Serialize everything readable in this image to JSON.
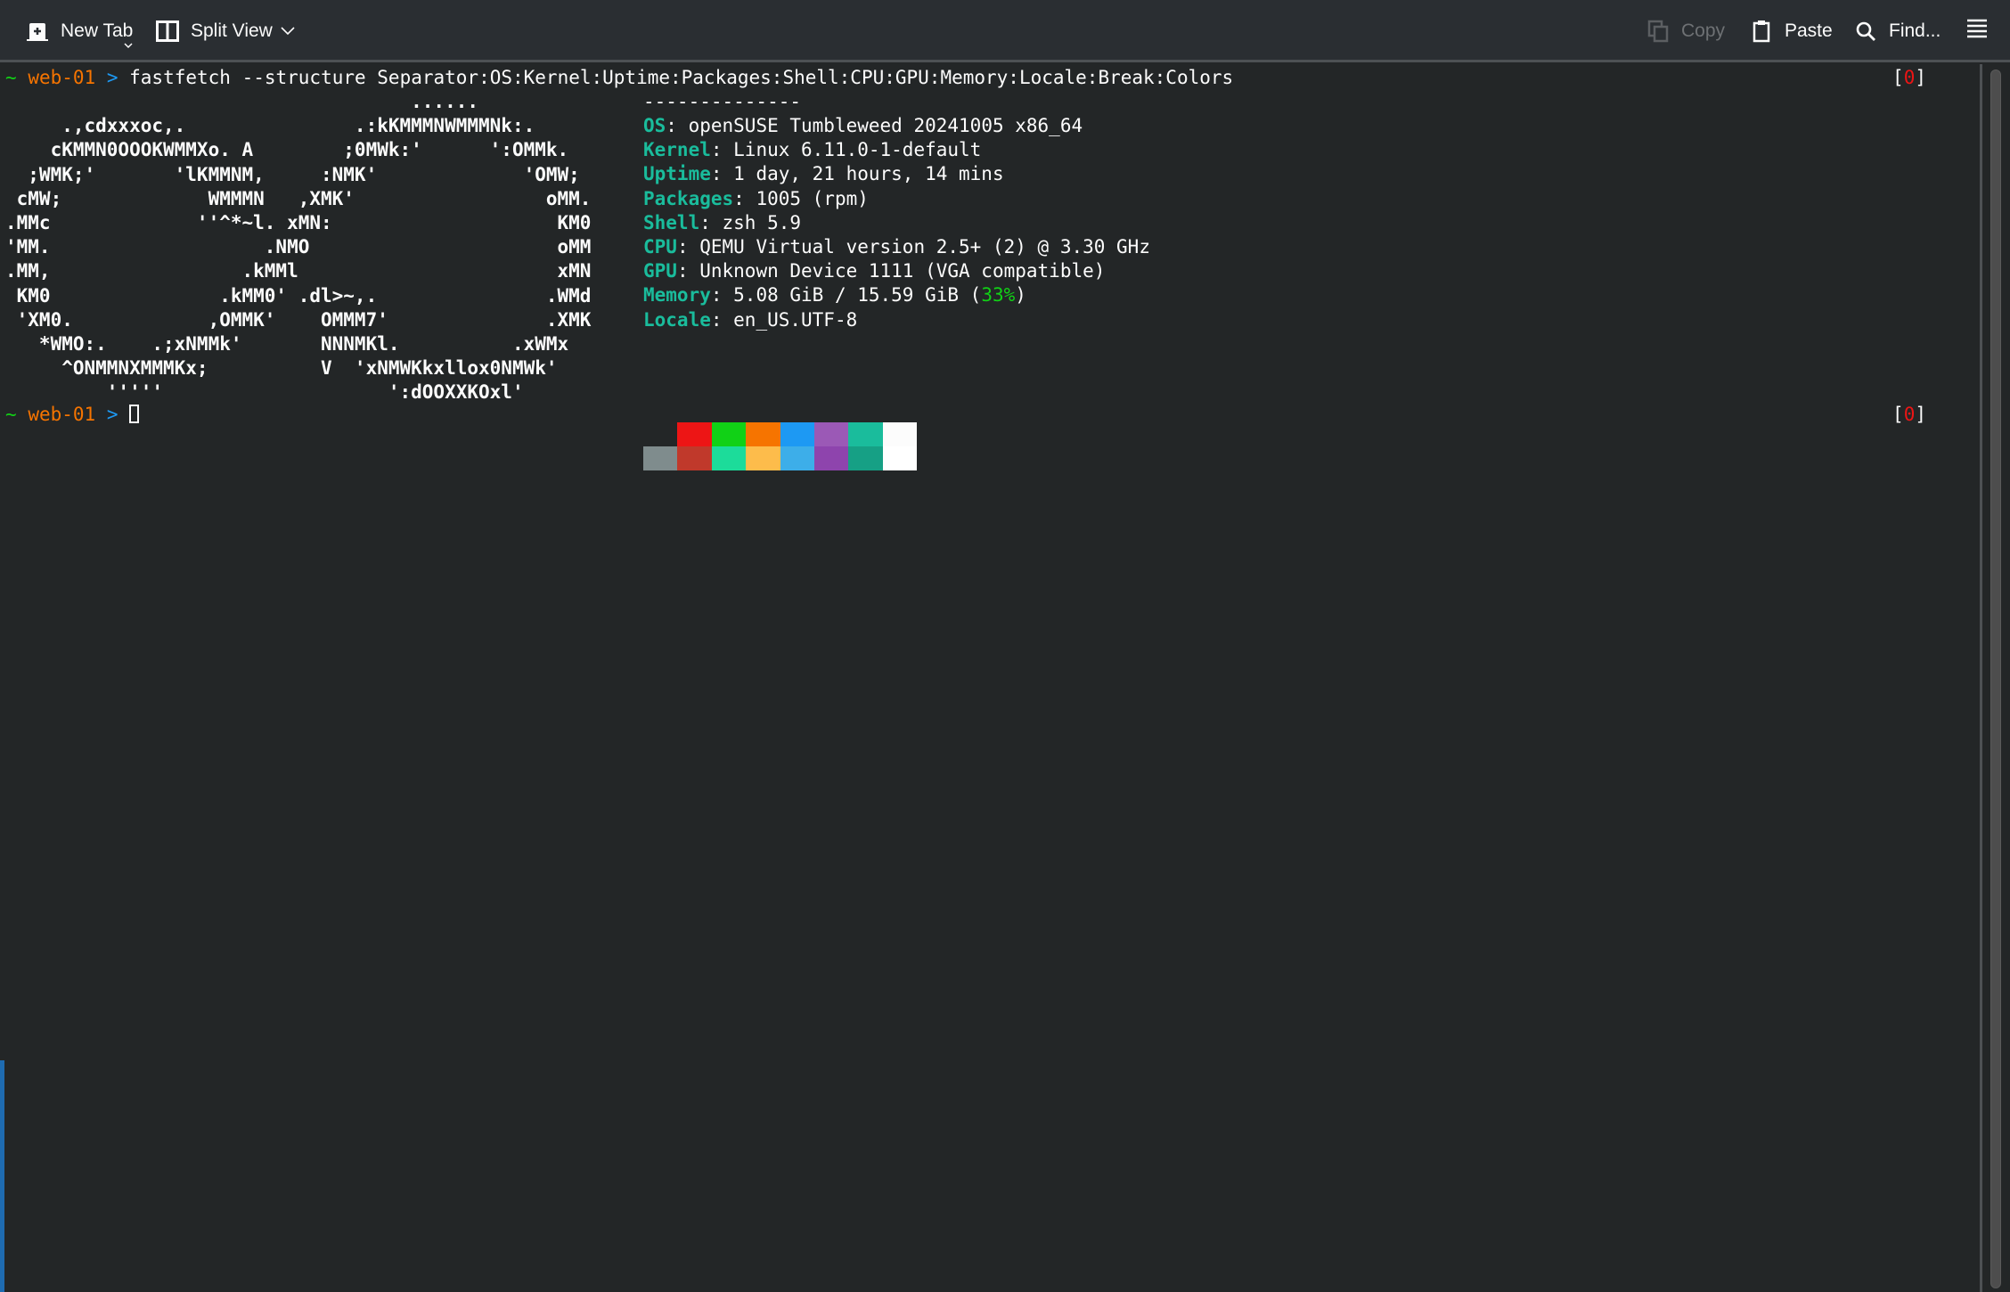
{
  "toolbar": {
    "new_tab": {
      "label": "New Tab",
      "icon": "new-tab-icon"
    },
    "split_view": {
      "label": "Split View",
      "icon": "split-view-icon"
    },
    "copy": {
      "label": "Copy",
      "icon": "copy-icon",
      "enabled": false
    },
    "paste": {
      "label": "Paste",
      "icon": "clipboard-icon"
    },
    "find": {
      "label": "Find...",
      "icon": "search-icon"
    },
    "menu": {
      "icon": "hamburger-menu-icon"
    }
  },
  "prompt": {
    "tilde": "~",
    "host": "web-01",
    "arrow": ">",
    "command": "fastfetch --structure Separator:OS:Kernel:Uptime:Packages:Shell:CPU:GPU:Memory:Locale:Break:Colors",
    "exit_open": "[",
    "exit_code": "0",
    "exit_close": "]"
  },
  "ascii_art": [
    "                                    ......",
    "     .,cdxxxoc,.               .:kKMMMNWMMMNk:.",
    "    cKMMN0OOOKWMMXo. A        ;0MWk:'      ':OMMk.",
    "  ;WMK;'       'lKMMNM,     :NMK'             'OMW;",
    " cMW;             WMMMN   ,XMK'                 oMM.",
    ".MMc             ''^*~l. xMN:                    KM0",
    "'MM.                   .NMO                      oMM",
    ".MM,                 .kMMl                       xMN",
    " KM0               .kMM0' .dl>~,.               .WMd",
    " 'XM0.            ,OMMK'    OMMM7'              .XMK",
    "   *WMO:.    .;xNMMk'       NNNMKl.          .xWMx",
    "     ^ONMMNXMMMKx;          V  'xNMWKkxllox0NMWk'",
    "         '''''                    ':dOOXXKOxl'"
  ],
  "info": {
    "separator": "--------------",
    "rows": [
      {
        "key": "OS",
        "value": "openSUSE Tumbleweed 20241005 x86_64"
      },
      {
        "key": "Kernel",
        "value": "Linux 6.11.0-1-default"
      },
      {
        "key": "Uptime",
        "value": "1 day, 21 hours, 14 mins"
      },
      {
        "key": "Packages",
        "value": "1005 (rpm)"
      },
      {
        "key": "Shell",
        "value": "zsh 5.9"
      },
      {
        "key": "CPU",
        "value": "QEMU Virtual version 2.5+ (2) @ 3.30 GHz"
      },
      {
        "key": "GPU",
        "value": "Unknown Device 1111 (VGA compatible)"
      },
      {
        "key": "Memory",
        "value_pre": "5.08 GiB / 15.59 GiB (",
        "percent": "33%",
        "value_post": ")"
      },
      {
        "key": "Locale",
        "value": "en_US.UTF-8"
      }
    ],
    "colors_top": [
      "#232627",
      "#ed1515",
      "#11d116",
      "#f67400",
      "#1d99f3",
      "#9b59b6",
      "#1abc9c",
      "#fcfcfc"
    ],
    "colors_bottom": [
      "#7f8c8d",
      "#c0392b",
      "#1cdc9a",
      "#fdbc4b",
      "#3daee9",
      "#8e44ad",
      "#16a085",
      "#ffffff"
    ]
  },
  "colors": {
    "background": "#232627",
    "toolbar": "#2a2e32",
    "key": "#1abc9c",
    "host": "#f67400",
    "arrow": "#1d99f3",
    "tilde": "#11d116",
    "exit_code": "#ed1515"
  }
}
